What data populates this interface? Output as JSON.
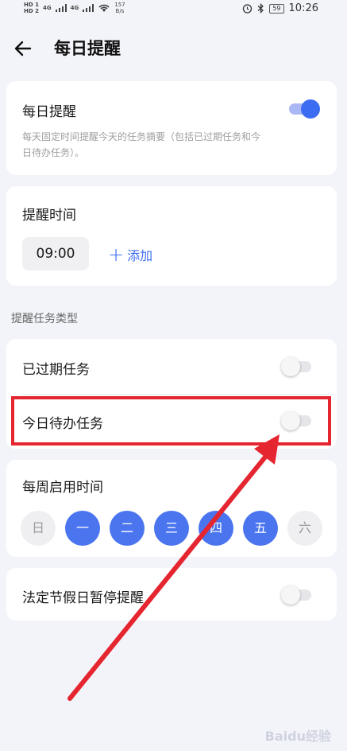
{
  "status_bar": {
    "hd_top": "HD 1",
    "hd_bottom": "HD 2",
    "net_1": "4G",
    "net_2": "4G",
    "speed_value": "157",
    "speed_unit": "B/s",
    "battery": "59",
    "time": "10:26"
  },
  "header": {
    "title": "每日提醒"
  },
  "daily_card": {
    "title": "每日提醒",
    "description": "每天固定时间提醒今天的任务摘要（包括已过期任务和今日待办任务）。",
    "enabled": true
  },
  "time_card": {
    "title": "提醒时间",
    "time": "09:00",
    "add_label": "添加"
  },
  "section_label": "提醒任务类型",
  "task_types": [
    {
      "label": "已过期任务",
      "enabled": false
    },
    {
      "label": "今日待办任务",
      "enabled": false
    }
  ],
  "weekly_card": {
    "title": "每周启用时间",
    "days": [
      {
        "label": "日",
        "active": false
      },
      {
        "label": "一",
        "active": true
      },
      {
        "label": "二",
        "active": true
      },
      {
        "label": "三",
        "active": true
      },
      {
        "label": "四",
        "active": true
      },
      {
        "label": "五",
        "active": true
      },
      {
        "label": "六",
        "active": false
      }
    ]
  },
  "holiday_card": {
    "title": "法定节假日暂停提醒",
    "enabled": false
  },
  "colors": {
    "accent": "#3c6cf2",
    "annotation": "#e5252f",
    "background": "#f3f4f9"
  },
  "icons": {
    "back": "arrow-left-icon"
  },
  "watermark": "Baidu经验"
}
